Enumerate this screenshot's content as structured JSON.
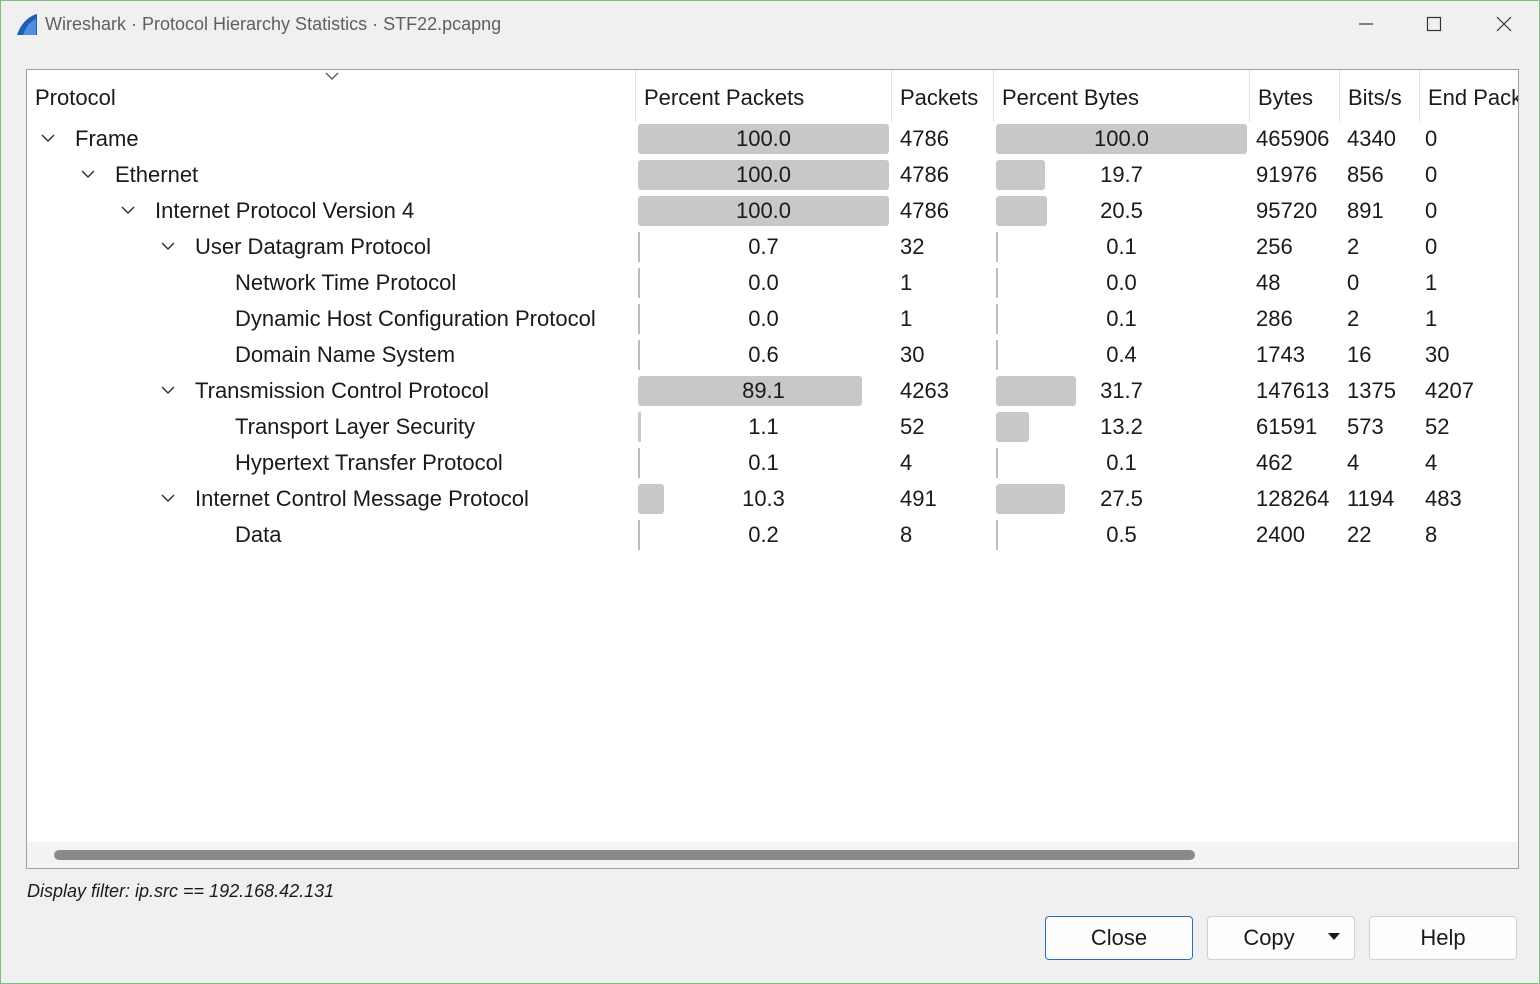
{
  "window": {
    "title": "Wireshark · Protocol Hierarchy Statistics · STF22.pcapng"
  },
  "columns": [
    "Protocol",
    "Percent Packets",
    "Packets",
    "Percent Bytes",
    "Bytes",
    "Bits/s",
    "End Pack"
  ],
  "rows": [
    {
      "protocol": "Frame",
      "level": 0,
      "expandable": true,
      "pct_packets": "100.0",
      "packets": "4786",
      "pct_bytes": "100.0",
      "bytes": "465906",
      "bits_s": "4340",
      "end_packets": "0",
      "pct_packets_value": 100.0,
      "pct_bytes_value": 100.0
    },
    {
      "protocol": "Ethernet",
      "level": 1,
      "expandable": true,
      "pct_packets": "100.0",
      "packets": "4786",
      "pct_bytes": "19.7",
      "bytes": "91976",
      "bits_s": "856",
      "end_packets": "0",
      "pct_packets_value": 100.0,
      "pct_bytes_value": 19.7
    },
    {
      "protocol": "Internet Protocol Version 4",
      "level": 2,
      "expandable": true,
      "pct_packets": "100.0",
      "packets": "4786",
      "pct_bytes": "20.5",
      "bytes": "95720",
      "bits_s": "891",
      "end_packets": "0",
      "pct_packets_value": 100.0,
      "pct_bytes_value": 20.5
    },
    {
      "protocol": "User Datagram Protocol",
      "level": 3,
      "expandable": true,
      "pct_packets": "0.7",
      "packets": "32",
      "pct_bytes": "0.1",
      "bytes": "256",
      "bits_s": "2",
      "end_packets": "0",
      "pct_packets_value": 0.7,
      "pct_bytes_value": 0.1
    },
    {
      "protocol": "Network Time Protocol",
      "level": 4,
      "expandable": false,
      "pct_packets": "0.0",
      "packets": "1",
      "pct_bytes": "0.0",
      "bytes": "48",
      "bits_s": "0",
      "end_packets": "1",
      "pct_packets_value": 0.0,
      "pct_bytes_value": 0.0
    },
    {
      "protocol": "Dynamic Host Configuration Protocol",
      "level": 4,
      "expandable": false,
      "pct_packets": "0.0",
      "packets": "1",
      "pct_bytes": "0.1",
      "bytes": "286",
      "bits_s": "2",
      "end_packets": "1",
      "pct_packets_value": 0.0,
      "pct_bytes_value": 0.1
    },
    {
      "protocol": "Domain Name System",
      "level": 4,
      "expandable": false,
      "pct_packets": "0.6",
      "packets": "30",
      "pct_bytes": "0.4",
      "bytes": "1743",
      "bits_s": "16",
      "end_packets": "30",
      "pct_packets_value": 0.6,
      "pct_bytes_value": 0.4
    },
    {
      "protocol": "Transmission Control Protocol",
      "level": 3,
      "expandable": true,
      "pct_packets": "89.1",
      "packets": "4263",
      "pct_bytes": "31.7",
      "bytes": "147613",
      "bits_s": "1375",
      "end_packets": "4207",
      "pct_packets_value": 89.1,
      "pct_bytes_value": 31.7
    },
    {
      "protocol": "Transport Layer Security",
      "level": 4,
      "expandable": false,
      "pct_packets": "1.1",
      "packets": "52",
      "pct_bytes": "13.2",
      "bytes": "61591",
      "bits_s": "573",
      "end_packets": "52",
      "pct_packets_value": 1.1,
      "pct_bytes_value": 13.2
    },
    {
      "protocol": "Hypertext Transfer Protocol",
      "level": 4,
      "expandable": false,
      "pct_packets": "0.1",
      "packets": "4",
      "pct_bytes": "0.1",
      "bytes": "462",
      "bits_s": "4",
      "end_packets": "4",
      "pct_packets_value": 0.1,
      "pct_bytes_value": 0.1
    },
    {
      "protocol": "Internet Control Message Protocol",
      "level": 3,
      "expandable": true,
      "pct_packets": "10.3",
      "packets": "491",
      "pct_bytes": "27.5",
      "bytes": "128264",
      "bits_s": "1194",
      "end_packets": "483",
      "pct_packets_value": 10.3,
      "pct_bytes_value": 27.5
    },
    {
      "protocol": "Data",
      "level": 4,
      "expandable": false,
      "pct_packets": "0.2",
      "packets": "8",
      "pct_bytes": "0.5",
      "bytes": "2400",
      "bits_s": "22",
      "end_packets": "8",
      "pct_packets_value": 0.2,
      "pct_bytes_value": 0.5
    }
  ],
  "footer": {
    "display_filter": "Display filter: ip.src == 192.168.42.131"
  },
  "buttons": {
    "close": "Close",
    "copy": "Copy",
    "help": "Help"
  },
  "colors": {
    "bar": "#c8c8c8",
    "primary_border": "#2a6fb5"
  }
}
